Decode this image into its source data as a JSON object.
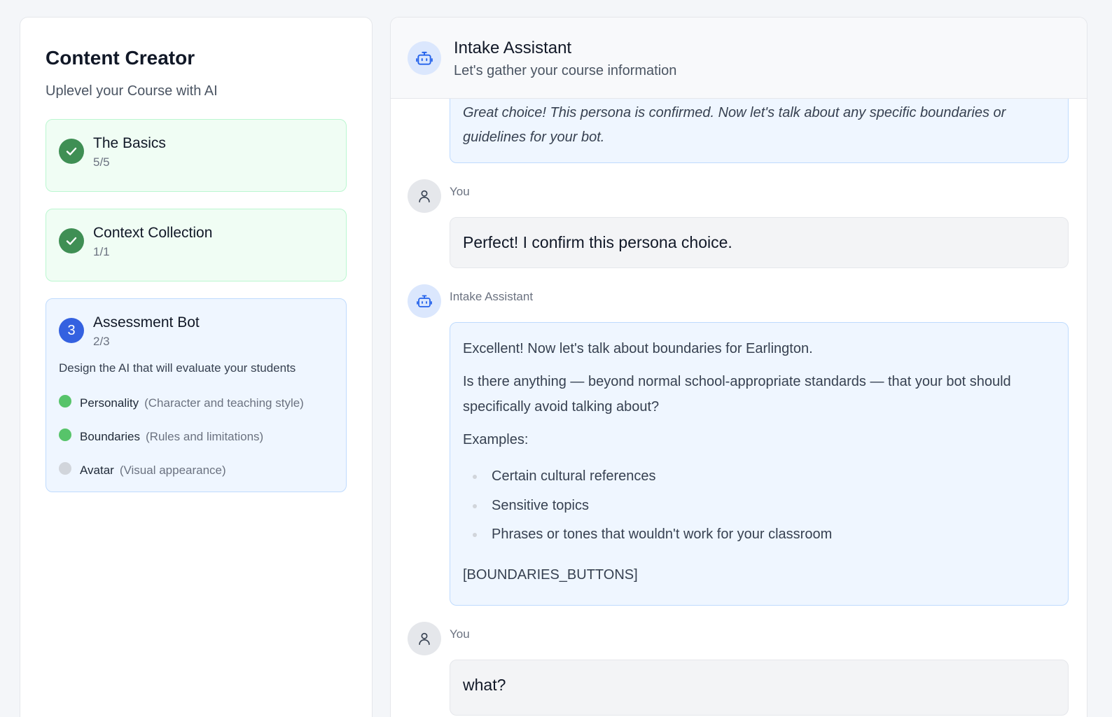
{
  "sidebar": {
    "title": "Content Creator",
    "subtitle": "Uplevel your Course with AI",
    "steps": [
      {
        "title": "The Basics",
        "count": "5/5",
        "status": "complete"
      },
      {
        "title": "Context Collection",
        "count": "1/1",
        "status": "complete"
      },
      {
        "number": "3",
        "title": "Assessment Bot",
        "count": "2/3",
        "status": "active",
        "description": "Design the AI that will evaluate your students",
        "subitems": [
          {
            "name": "Personality",
            "hint": "(Character and teaching style)",
            "done": true
          },
          {
            "name": "Boundaries",
            "hint": "(Rules and limitations)",
            "done": true
          },
          {
            "name": "Avatar",
            "hint": "(Visual appearance)",
            "done": false
          }
        ]
      }
    ]
  },
  "chat": {
    "header": {
      "title": "Intake Assistant",
      "subtitle": "Let's gather your course information"
    },
    "messages": [
      {
        "role": "bot",
        "text": "Great choice! This persona is confirmed. Now let's talk about any specific boundaries or guidelines for your bot."
      },
      {
        "role": "user",
        "sender": "You",
        "text": "Perfect! I confirm this persona choice."
      },
      {
        "role": "bot",
        "sender": "Intake Assistant",
        "paragraphs": [
          "Excellent! Now let's talk about boundaries for Earlington.",
          "Is there anything — beyond normal school-appropriate standards — that your bot should specifically avoid talking about?",
          "Examples:"
        ],
        "list": [
          "Certain cultural references",
          "Sensitive topics",
          "Phrases or tones that wouldn't work for your classroom"
        ],
        "tail": "[BOUNDARIES_BUTTONS]"
      },
      {
        "role": "user",
        "sender": "You",
        "text": "what?"
      }
    ]
  },
  "colors": {
    "complete_green": "#3f8f54",
    "active_blue": "#3461e0",
    "bot_bubble": "#eff6ff",
    "user_bubble": "#f3f4f6"
  },
  "icons": {
    "check": "check-icon",
    "bot": "robot-icon",
    "user": "user-icon"
  }
}
